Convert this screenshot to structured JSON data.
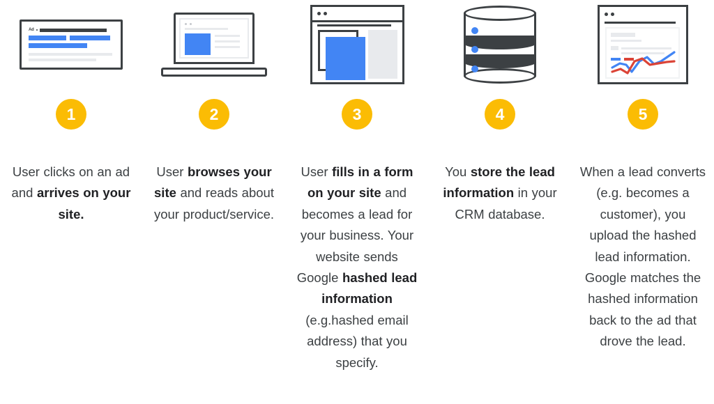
{
  "theme": {
    "accent_badge": "#FBBC04",
    "blue": "#4285F4",
    "red": "#DB4437",
    "dark": "#3C4043",
    "light_grey": "#E8EAED",
    "background": "#FFFFFF"
  },
  "steps": [
    {
      "number": "1",
      "icon": "search-ad-card-icon",
      "ad_label": "Ad",
      "caption_html": "User clicks on an ad and <b>arrives on your site.</b>",
      "caption_plain": "User clicks on an ad and arrives on your site."
    },
    {
      "number": "2",
      "icon": "laptop-website-icon",
      "caption_html": "User <b>browses your site</b> and reads about your product/service.",
      "caption_plain": "User browses your site and reads about your product/service."
    },
    {
      "number": "3",
      "icon": "browser-form-window-icon",
      "caption_html": "User <b>fills in a form on your site</b> and becomes a lead for your business. Your website sends Google <b>hashed lead information</b> (e.g.hashed email address) that you specify.",
      "caption_plain": "User fills in a form on your site and becomes a lead for your business. Your website sends Google hashed lead information (e.g.hashed email address) that you specify."
    },
    {
      "number": "4",
      "icon": "database-cylinder-icon",
      "caption_html": "You <b>store the lead information</b> in your CRM database.",
      "caption_plain": "You store the lead information in your CRM database."
    },
    {
      "number": "5",
      "icon": "analytics-chart-window-icon",
      "caption_html": "When a lead converts (e.g. becomes a customer), you upload the hashed lead information. Google matches the hashed information back to the ad that drove the lead.",
      "caption_plain": "When a lead converts (e.g. becomes a customer), you upload the hashed lead information. Google matches the hashed information back to the ad that drove the lead."
    }
  ]
}
